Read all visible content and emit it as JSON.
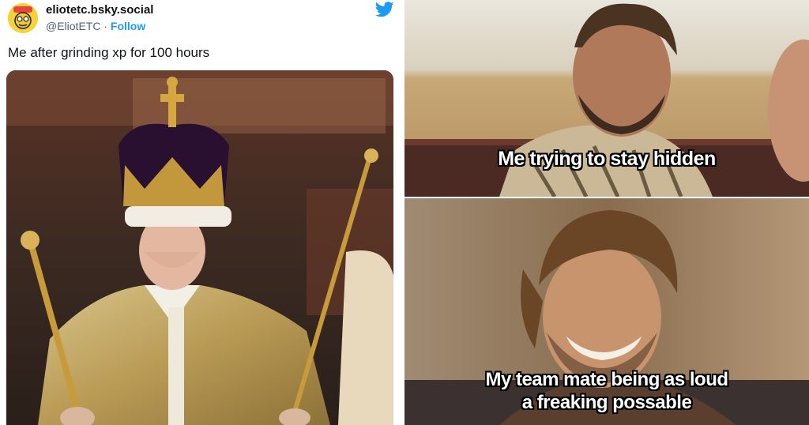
{
  "tweet": {
    "display_name": "eliotetc.bsky.social",
    "handle": "@EliotETC",
    "separator": " · ",
    "follow_label": "Follow",
    "text": "Me after grinding xp for 100 hours",
    "icon": "twitter-bird-icon",
    "accent_color": "#1d9bf0"
  },
  "meme": {
    "top_caption": "Me trying to stay hidden",
    "bottom_caption_line1": "My team mate being as loud",
    "bottom_caption_line2": "a freaking possable"
  }
}
